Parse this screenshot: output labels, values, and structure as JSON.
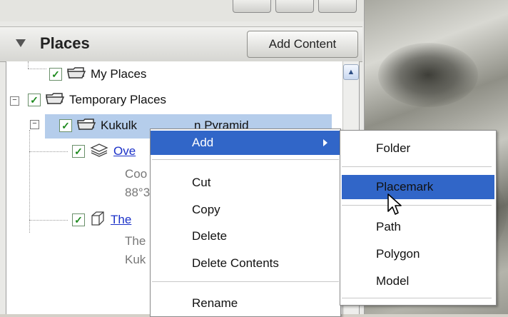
{
  "places_panel": {
    "title": "Places",
    "add_content_label": "Add Content"
  },
  "tree": {
    "my_places": "My Places",
    "temporary_places": "Temporary Places",
    "kukulkan_partial": "Kukulk",
    "kukulkan_tail": "n Pyramid",
    "overlay_link": "Ove",
    "overlay_line2": "Coo",
    "overlay_line3": "88°3",
    "model_link": "The",
    "model_line2": "The",
    "model_line3": "Kuk"
  },
  "context_menu": {
    "add": "Add",
    "cut": "Cut",
    "copy": "Copy",
    "delete": "Delete",
    "delete_contents": "Delete Contents",
    "rename": "Rename"
  },
  "add_submenu": {
    "folder": "Folder",
    "placemark": "Placemark",
    "path": "Path",
    "polygon": "Polygon",
    "model": "Model"
  },
  "colors": {
    "menu_highlight": "#3166c8",
    "selection": "#b5cdeb",
    "link": "#1a30c8"
  }
}
